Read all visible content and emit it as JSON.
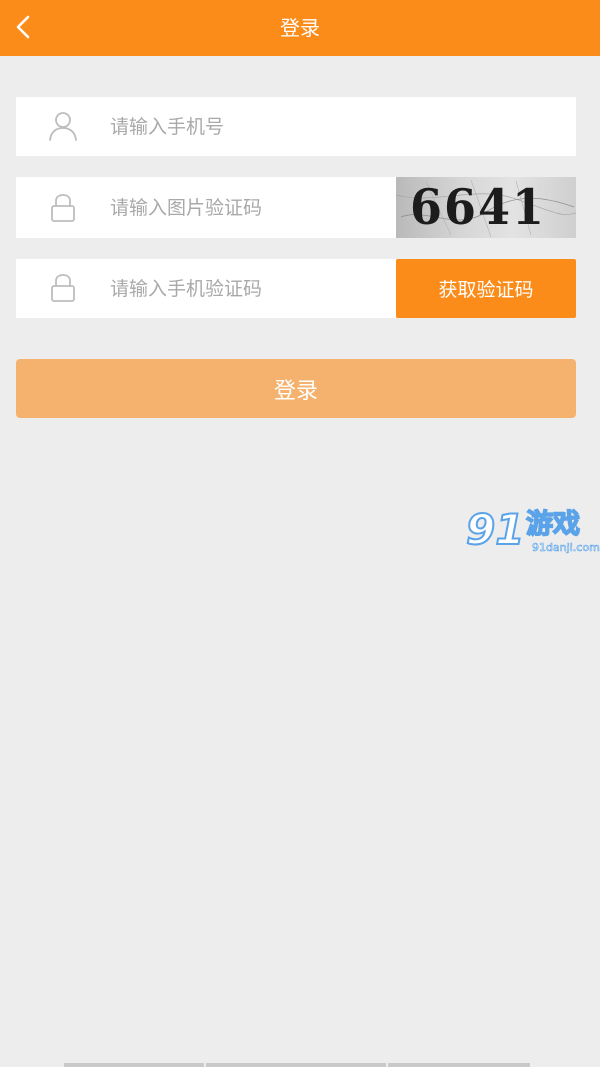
{
  "header": {
    "title": "登录",
    "back_icon": "chevron-left-icon",
    "background_color": "#fb8c1a"
  },
  "form": {
    "phone": {
      "icon": "user-icon",
      "placeholder": "请输入手机号",
      "value": ""
    },
    "image_code": {
      "icon": "lock-icon",
      "placeholder": "请输入图片验证码",
      "value": "",
      "captcha_text": "6641"
    },
    "sms_code": {
      "icon": "lock-icon",
      "placeholder": "请输入手机验证码",
      "value": "",
      "button_label": "获取验证码"
    }
  },
  "login_button": {
    "label": "登录",
    "color": "#f4b26e"
  },
  "watermark": {
    "logo": "91",
    "name": "游戏",
    "domain": "91danji.com"
  },
  "colors": {
    "accent": "#fb8c1a",
    "page_background": "#ededed",
    "placeholder": "#a9a9a9"
  }
}
